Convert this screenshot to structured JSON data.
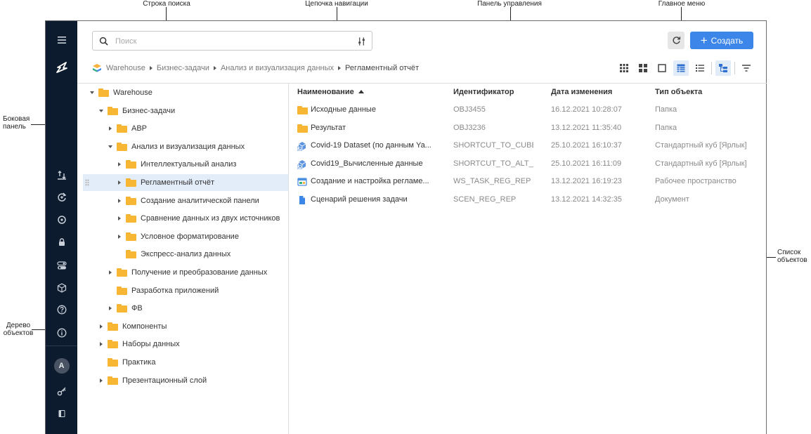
{
  "callouts": {
    "search_bar": "Строка поиска",
    "breadcrumb": "Цепочка навигации",
    "control_panel": "Панель управления",
    "main_menu": "Главное меню",
    "sidebar": "Боковая\nпанель",
    "object_list": "Список\nобъектов",
    "object_tree": "Дерево\nобъектов"
  },
  "colors": {
    "accent": "#3b86e8",
    "sidebar_bg": "#0d1b2e",
    "callout_dot": "#1f73c9",
    "folder": "#f7b734"
  },
  "sidebar": {
    "avatar_letter": "A",
    "icons": [
      "menu-icon",
      "logo-icon",
      "upload-icon",
      "refresh-add-icon",
      "sync-icon",
      "lock-icon",
      "toggle-icon",
      "cube-icon",
      "help-icon",
      "info-icon",
      "key-icon",
      "book-icon"
    ]
  },
  "search": {
    "placeholder": "Поиск"
  },
  "header": {
    "create_label": "Создать"
  },
  "breadcrumb": [
    "Warehouse",
    "Бизнес-задачи",
    "Анализ и визуализация данных",
    "Регламентный отчёт"
  ],
  "toolbar": [
    "grid-large-icon",
    "grid-small-icon",
    "tile-icon",
    "table-icon",
    "list-icon",
    "tree-view-icon",
    "filter-icon"
  ],
  "tree": [
    {
      "label": "Warehouse",
      "level": 0,
      "caret": "down"
    },
    {
      "label": "Бизнес-задачи",
      "level": 1,
      "caret": "down"
    },
    {
      "label": "АВР",
      "level": 2,
      "caret": "right"
    },
    {
      "label": "Анализ и визуализация данных",
      "level": 2,
      "caret": "down"
    },
    {
      "label": "Интеллектуальный анализ",
      "level": 3,
      "caret": "right"
    },
    {
      "label": "Регламентный отчёт",
      "level": 3,
      "caret": "right",
      "selected": true
    },
    {
      "label": "Создание аналитической панели",
      "level": 3,
      "caret": "right"
    },
    {
      "label": "Сравнение данных из двух источников",
      "level": 3,
      "caret": "right"
    },
    {
      "label": "Условное форматирование",
      "level": 3,
      "caret": "right"
    },
    {
      "label": "Экспресс-анализ данных",
      "level": 3,
      "caret": "none"
    },
    {
      "label": "Получение и преобразование данных",
      "level": 2,
      "caret": "right"
    },
    {
      "label": "Разработка приложений",
      "level": 2,
      "caret": "none"
    },
    {
      "label": "ФВ",
      "level": 2,
      "caret": "right"
    },
    {
      "label": "Компоненты",
      "level": 1,
      "caret": "right"
    },
    {
      "label": "Наборы данных",
      "level": 1,
      "caret": "right"
    },
    {
      "label": "Практика",
      "level": 1,
      "caret": "none"
    },
    {
      "label": "Презентационный слой",
      "level": 1,
      "caret": "right"
    }
  ],
  "list": {
    "columns": {
      "name": "Наименование",
      "id": "Идентификатор",
      "date": "Дата изменения",
      "type": "Тип объекта"
    },
    "rows": [
      {
        "icon": "folder-icon",
        "name": "Исходные данные",
        "id": "OBJ3455",
        "date": "16.12.2021 10:28:07",
        "type": "Папка"
      },
      {
        "icon": "folder-icon",
        "name": "Результат",
        "id": "OBJ3236",
        "date": "13.12.2021 11:35:40",
        "type": "Папка"
      },
      {
        "icon": "cube-shortcut-icon",
        "name": "Covid-19 Dataset (по данным Ya...",
        "id": "SHORTCUT_TO_CUBE_",
        "date": "25.10.2021 16:10:37",
        "type": "Стандартный куб [Ярлык]"
      },
      {
        "icon": "cube-shortcut-icon",
        "name": "Covid19_Вычисленные данные",
        "id": "SHORTCUT_TO_ALT_CI",
        "date": "25.10.2021 16:11:09",
        "type": "Стандартный куб [Ярлык]"
      },
      {
        "icon": "workspace-icon",
        "name": "Создание и настройка регламе...",
        "id": "WS_TASK_REG_REP",
        "date": "13.12.2021 16:19:23",
        "type": "Рабочее пространство"
      },
      {
        "icon": "document-icon",
        "name": "Сценарий решения задачи",
        "id": "SCEN_REG_REP",
        "date": "13.12.2021 14:32:35",
        "type": "Документ"
      }
    ]
  }
}
